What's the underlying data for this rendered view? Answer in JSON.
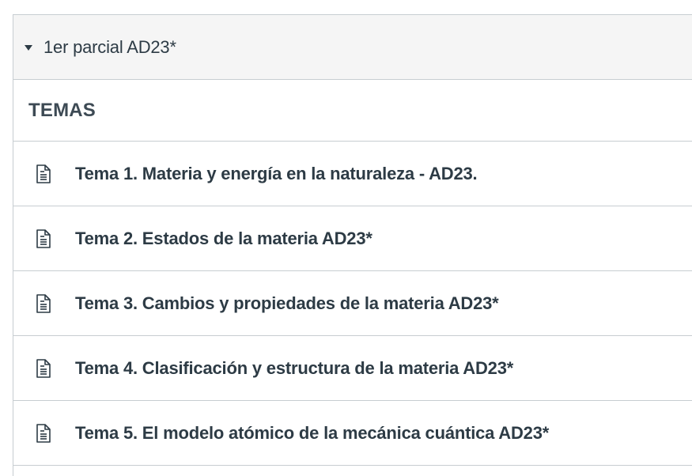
{
  "module": {
    "title": "1er parcial AD23*",
    "subheader": "TEMAS",
    "items": [
      {
        "icon": "page-icon",
        "label": "Tema 1. Materia y energía en la naturaleza - AD23."
      },
      {
        "icon": "page-icon",
        "label": "Tema 2. Estados de la materia AD23*"
      },
      {
        "icon": "page-icon",
        "label": "Tema 3. Cambios y propiedades de la materia AD23*"
      },
      {
        "icon": "page-icon",
        "label": "Tema 4. Clasificación y estructura de la materia AD23*"
      },
      {
        "icon": "page-icon",
        "label": "Tema 5. El modelo atómico de la mecánica cuántica AD23*"
      }
    ]
  },
  "colors": {
    "text": "#2d3b45",
    "header_bg": "#f5f5f5",
    "border": "#c7cdd1"
  }
}
